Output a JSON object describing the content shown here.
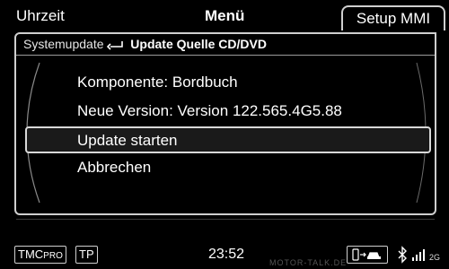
{
  "tabs": {
    "left": "Uhrzeit",
    "center": "Menü",
    "right": "Setup MMI"
  },
  "header": {
    "breadcrumb": "Systemupdate",
    "title": "Update Quelle CD/DVD"
  },
  "items": {
    "component": "Komponente: Bordbuch",
    "new_version": "Neue Version: Version 122.565.4G5.88",
    "start_update": "Update starten",
    "cancel": "Abbrechen"
  },
  "status_bar": {
    "tmc": "TMC",
    "tmc_sub": "PRO",
    "tp": "TP",
    "time": "23:52",
    "network": "2G",
    "watermark": "MOTOR-TALK.DE"
  },
  "colors": {
    "background": "#000000",
    "text": "#ffffff",
    "frame": "#cfcfcf",
    "selection_fill": "#1a1a1a"
  },
  "icons": {
    "back": "return-arrow-icon",
    "phone_car": "phone-car-icon",
    "bluetooth": "bluetooth-icon",
    "signal": "signal-icon"
  }
}
